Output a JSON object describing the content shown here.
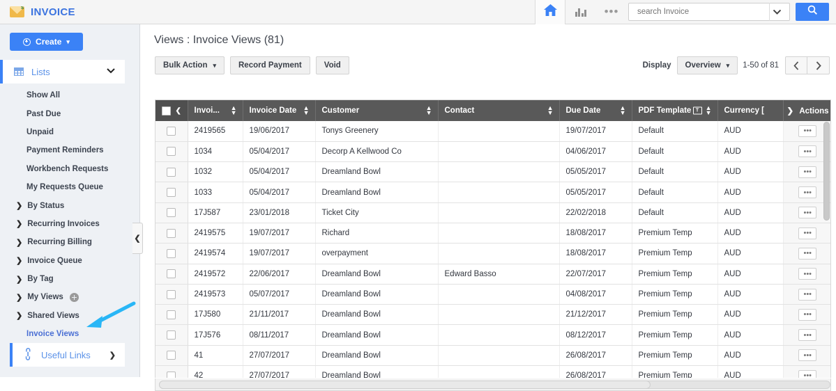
{
  "header": {
    "brand": "INVOICE",
    "logo_icon": "envelope-dollar-icon",
    "home_icon": "home-icon",
    "reports_icon": "bar-chart-icon",
    "more_icon": "ellipsis-icon",
    "search": {
      "placeholder": "search Invoice",
      "value": "",
      "dropdown_icon": "chevron-down-icon",
      "button_icon": "search-icon"
    }
  },
  "sidebar": {
    "create_label": "Create",
    "create_icon": "plus-circle-icon",
    "create_caret": "▾",
    "panel": {
      "label": "Lists",
      "icon": "grid-icon",
      "chevron": "⌄"
    },
    "items": [
      {
        "label": "Show All",
        "type": "plain"
      },
      {
        "label": "Past Due",
        "type": "plain"
      },
      {
        "label": "Unpaid",
        "type": "plain"
      },
      {
        "label": "Payment Reminders",
        "type": "plain"
      },
      {
        "label": "Workbench Requests",
        "type": "plain"
      },
      {
        "label": "My Requests Queue",
        "type": "plain"
      },
      {
        "label": "By Status",
        "type": "group"
      },
      {
        "label": "Recurring Invoices",
        "type": "group"
      },
      {
        "label": "Recurring Billing",
        "type": "group"
      },
      {
        "label": "Invoice Queue",
        "type": "group"
      },
      {
        "label": "By Tag",
        "type": "group"
      },
      {
        "label": "My Views",
        "type": "group-add"
      },
      {
        "label": "Shared Views",
        "type": "group"
      },
      {
        "label": "Invoice Views",
        "type": "link"
      }
    ],
    "group_arrow": "❯",
    "useful_links": {
      "label": "Useful Links",
      "icon": "link-icon",
      "chevron": "❯"
    },
    "collapse_handle": "❮"
  },
  "main": {
    "page_title": "Views : Invoice Views (81)",
    "buttons": [
      {
        "label": "Bulk Action",
        "caret": "▾"
      },
      {
        "label": "Record Payment",
        "caret": ""
      },
      {
        "label": "Void",
        "caret": ""
      }
    ],
    "display": {
      "label": "Display",
      "selected": "Overview",
      "caret": "▾",
      "range": "1-50 of 81",
      "prev_icon": "chevron-left-icon",
      "next_icon": "chevron-right-icon"
    }
  },
  "table": {
    "select_all_arrow": "❮",
    "sort_icon": "sort-updown-icon",
    "filter_icon": "text-filter-icon",
    "actions_arrow": "❯",
    "row_action_label": "•••",
    "columns": [
      {
        "key": "checkbox",
        "label": "",
        "sortable": false
      },
      {
        "key": "invoice_no",
        "label": "Invoi...",
        "sortable": true
      },
      {
        "key": "invoice_date",
        "label": "Invoice Date",
        "sortable": true
      },
      {
        "key": "customer",
        "label": "Customer",
        "sortable": true
      },
      {
        "key": "contact",
        "label": "Contact",
        "sortable": true
      },
      {
        "key": "due_date",
        "label": "Due Date",
        "sortable": true
      },
      {
        "key": "pdf_template",
        "label": "PDF Template",
        "sortable": true,
        "filterable": true
      },
      {
        "key": "currency",
        "label": "Currency [",
        "sortable": false
      },
      {
        "key": "actions",
        "label": "Actions",
        "sortable": false
      }
    ],
    "rows": [
      {
        "invoice_no": "2419565",
        "invoice_date": "19/06/2017",
        "customer": "Tonys Greenery",
        "contact": "",
        "due_date": "19/07/2017",
        "pdf_template": "Default",
        "currency": "AUD"
      },
      {
        "invoice_no": "1034",
        "invoice_date": "05/04/2017",
        "customer": "Decorp A Kellwood Co",
        "contact": "",
        "due_date": "04/06/2017",
        "pdf_template": "Default",
        "currency": "AUD"
      },
      {
        "invoice_no": "1032",
        "invoice_date": "05/04/2017",
        "customer": "Dreamland Bowl",
        "contact": "",
        "due_date": "05/05/2017",
        "pdf_template": "Default",
        "currency": "AUD"
      },
      {
        "invoice_no": "1033",
        "invoice_date": "05/04/2017",
        "customer": "Dreamland Bowl",
        "contact": "",
        "due_date": "05/05/2017",
        "pdf_template": "Default",
        "currency": "AUD"
      },
      {
        "invoice_no": "17J587",
        "invoice_date": "23/01/2018",
        "customer": "Ticket City",
        "contact": "",
        "due_date": "22/02/2018",
        "pdf_template": "Default",
        "currency": "AUD"
      },
      {
        "invoice_no": "2419575",
        "invoice_date": "19/07/2017",
        "customer": "Richard",
        "contact": "",
        "due_date": "18/08/2017",
        "pdf_template": "Premium Temp",
        "currency": "AUD"
      },
      {
        "invoice_no": "2419574",
        "invoice_date": "19/07/2017",
        "customer": "overpayment",
        "contact": "",
        "due_date": "18/08/2017",
        "pdf_template": "Premium Temp",
        "currency": "AUD"
      },
      {
        "invoice_no": "2419572",
        "invoice_date": "22/06/2017",
        "customer": "Dreamland Bowl",
        "contact": "Edward Basso",
        "due_date": "22/07/2017",
        "pdf_template": "Premium Temp",
        "currency": "AUD"
      },
      {
        "invoice_no": "2419573",
        "invoice_date": "05/07/2017",
        "customer": "Dreamland Bowl",
        "contact": "",
        "due_date": "04/08/2017",
        "pdf_template": "Premium Temp",
        "currency": "AUD"
      },
      {
        "invoice_no": "17J580",
        "invoice_date": "21/11/2017",
        "customer": "Dreamland Bowl",
        "contact": "",
        "due_date": "21/12/2017",
        "pdf_template": "Premium Temp",
        "currency": "AUD"
      },
      {
        "invoice_no": "17J576",
        "invoice_date": "08/11/2017",
        "customer": "Dreamland Bowl",
        "contact": "",
        "due_date": "08/12/2017",
        "pdf_template": "Premium Temp",
        "currency": "AUD"
      },
      {
        "invoice_no": "41",
        "invoice_date": "27/07/2017",
        "customer": "Dreamland Bowl",
        "contact": "",
        "due_date": "26/08/2017",
        "pdf_template": "Premium Temp",
        "currency": "AUD"
      },
      {
        "invoice_no": "42",
        "invoice_date": "27/07/2017",
        "customer": "Dreamland Bowl",
        "contact": "",
        "due_date": "26/08/2017",
        "pdf_template": "Premium Temp",
        "currency": "AUD"
      }
    ]
  },
  "annotation": {
    "type": "arrow",
    "color": "#29b6f6",
    "points_to": "Invoice Views"
  },
  "colors": {
    "accent_blue": "#3b82f6",
    "link_blue": "#4a6fd4",
    "header_gray": "#595959",
    "sidebar_bg": "#eef1f5"
  }
}
